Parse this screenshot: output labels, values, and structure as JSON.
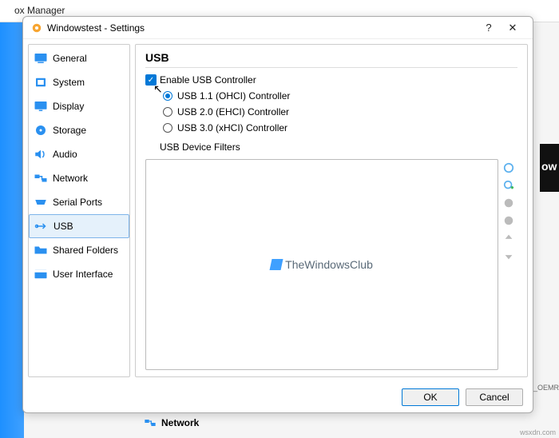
{
  "parent_window": {
    "title_fragment": "ox Manager",
    "right_fragment": "ow",
    "oem": "_OEMR"
  },
  "dialog": {
    "title": "Windowstest - Settings",
    "help": "?",
    "close": "✕",
    "sidebar": {
      "items": [
        {
          "label": "General"
        },
        {
          "label": "System"
        },
        {
          "label": "Display"
        },
        {
          "label": "Storage"
        },
        {
          "label": "Audio"
        },
        {
          "label": "Network"
        },
        {
          "label": "Serial Ports"
        },
        {
          "label": "USB"
        },
        {
          "label": "Shared Folders"
        },
        {
          "label": "User Interface"
        }
      ]
    },
    "panel": {
      "heading": "USB",
      "enable_label": "Enable USB Controller",
      "radios": [
        "USB 1.1 (OHCI) Controller",
        "USB 2.0 (EHCI) Controller",
        "USB 3.0 (xHCI) Controller"
      ],
      "filters_label": "USB Device Filters",
      "watermark": "TheWindowsClub"
    },
    "buttons": {
      "ok": "OK",
      "cancel": "Cancel"
    }
  },
  "below": {
    "network": "Network"
  },
  "credit": "wsxdn.com"
}
